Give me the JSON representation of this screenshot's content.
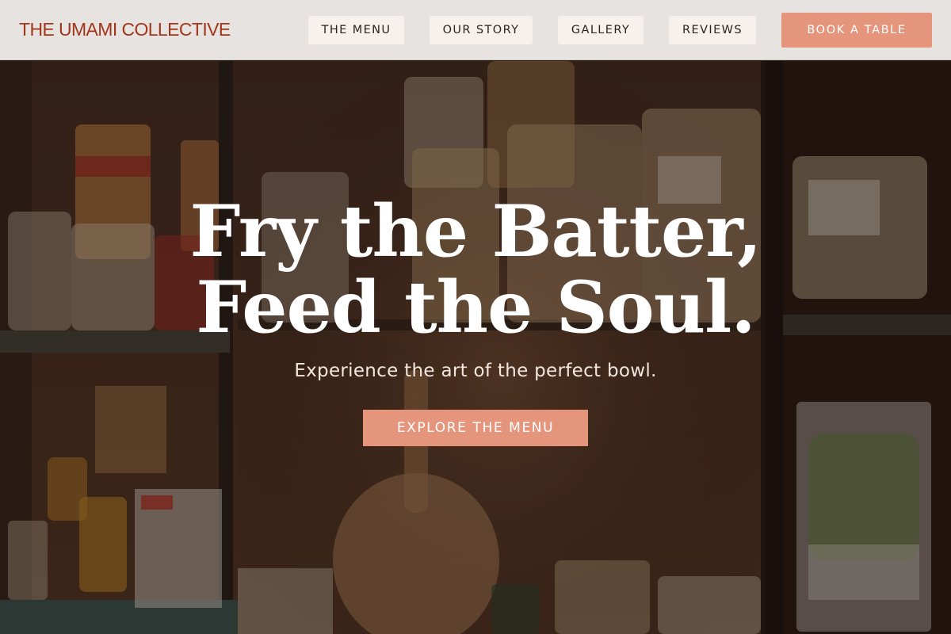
{
  "brand": {
    "name": "THE UMAMI COLLECTIVE",
    "color": "#a2361a"
  },
  "nav": {
    "items": [
      {
        "label": "THE MENU"
      },
      {
        "label": "OUR STORY"
      },
      {
        "label": "GALLERY"
      },
      {
        "label": "REVIEWS"
      }
    ],
    "cta_label": "BOOK A TABLE"
  },
  "hero": {
    "title_line1": "Fry the Batter,",
    "title_line2": "Feed the Soul.",
    "subtitle": "Experience the art of the perfect bowl.",
    "cta_label": "EXPLORE THE MENU",
    "accent_color": "#e5957b"
  }
}
